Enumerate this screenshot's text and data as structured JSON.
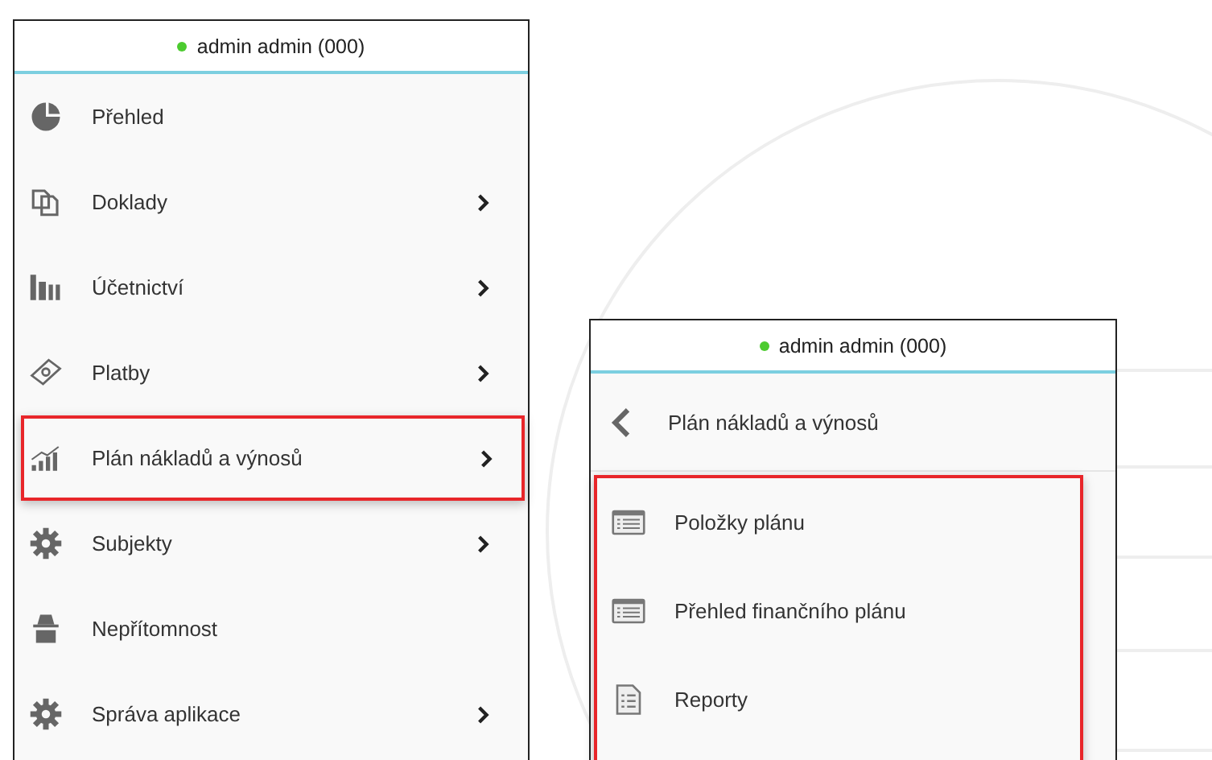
{
  "main_menu": {
    "user": {
      "name": "admin admin (000)",
      "online": true
    },
    "items": [
      {
        "label": "Přehled",
        "kind": "pie",
        "has_submenu": false,
        "highlighted": false
      },
      {
        "label": "Doklady",
        "kind": "documents",
        "has_submenu": true,
        "highlighted": false
      },
      {
        "label": "Účetnictví",
        "kind": "books",
        "has_submenu": true,
        "highlighted": false
      },
      {
        "label": "Platby",
        "kind": "money",
        "has_submenu": true,
        "highlighted": false
      },
      {
        "label": "Plán nákladů a výnosů",
        "kind": "chart",
        "has_submenu": true,
        "highlighted": true
      },
      {
        "label": "Subjekty",
        "kind": "gear",
        "has_submenu": true,
        "highlighted": false
      },
      {
        "label": "Nepřítomnost",
        "kind": "spy",
        "has_submenu": false,
        "highlighted": false
      },
      {
        "label": "Správa aplikace",
        "kind": "gear",
        "has_submenu": true,
        "highlighted": false
      }
    ]
  },
  "submenu": {
    "user": {
      "name": "admin admin (000)",
      "online": true
    },
    "back_label": "Plán nákladů a výnosů",
    "highlighted": true,
    "items": [
      {
        "label": "Položky plánu",
        "kind": "list"
      },
      {
        "label": "Přehled finančního plánu",
        "kind": "list"
      },
      {
        "label": "Reporty",
        "kind": "report"
      }
    ]
  }
}
